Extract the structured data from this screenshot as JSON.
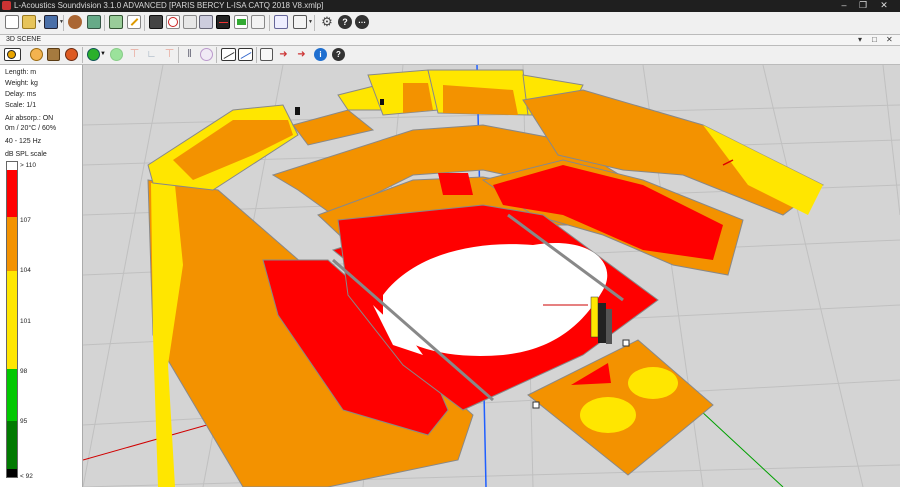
{
  "window": {
    "title": "L-Acoustics Soundvision 3.1.0 ADVANCED [PARIS BERCY L-ISA CATQ 2018 V8.xmlp]",
    "controls": [
      "minimize-icon",
      "restore-icon",
      "close-icon"
    ]
  },
  "toolbar": {
    "icons": [
      "new-file-icon",
      "open-file-icon",
      "save-icon",
      "loudspeaker-icon",
      "speaker-cabinet-icon",
      "pencil-icon",
      "select-icon",
      "source-icon",
      "view-icon",
      "camera-icon",
      "spectrum-icon",
      "move-icon",
      "grid-icon",
      "gear-icon",
      "help-icon",
      "more-icon"
    ]
  },
  "panel": {
    "title": "3D SCENE",
    "controls": [
      "pin-icon",
      "maximize-icon",
      "close-icon"
    ]
  },
  "scene_toolbar": {
    "icons": [
      "spl-mode-icon",
      "delay-mode-icon",
      "box-icon",
      "mapping-icon",
      "color-mode-icon",
      "clock-icon",
      "impact-icon",
      "graph-icon",
      "aim-icon",
      "split-icon",
      "balloon-icon",
      "angle-icon",
      "slope-icon",
      "export-icon",
      "ruler-icon",
      "zoom-icon",
      "info-icon",
      "help-icon"
    ]
  },
  "info": {
    "length": "Length: m",
    "weight": "Weight: kg",
    "delay": "Delay: ms",
    "scale": "Scale: 1/1",
    "air_absorption": "Air absorp.: ON",
    "conditions": "0m / 20°C / 60%",
    "band": "40 - 125 Hz",
    "scale_title": "dB SPL scale"
  },
  "spl_scale": {
    "labels": [
      "> 110",
      "107",
      "104",
      "101",
      "98",
      "95",
      "< 92"
    ],
    "colors": [
      "#ffffff",
      "#ff0000",
      "#ff8c00",
      "#ffe600",
      "#00c800",
      "#007a00",
      "#000000"
    ]
  },
  "colors": {
    "white": "#ffffff",
    "red": "#ff0000",
    "orange": "#f39200",
    "yellow": "#ffe600",
    "grid": "#c2c2c2",
    "axis_blue": "#1f5fff",
    "axis_red": "#d00000",
    "axis_green": "#00a000"
  }
}
